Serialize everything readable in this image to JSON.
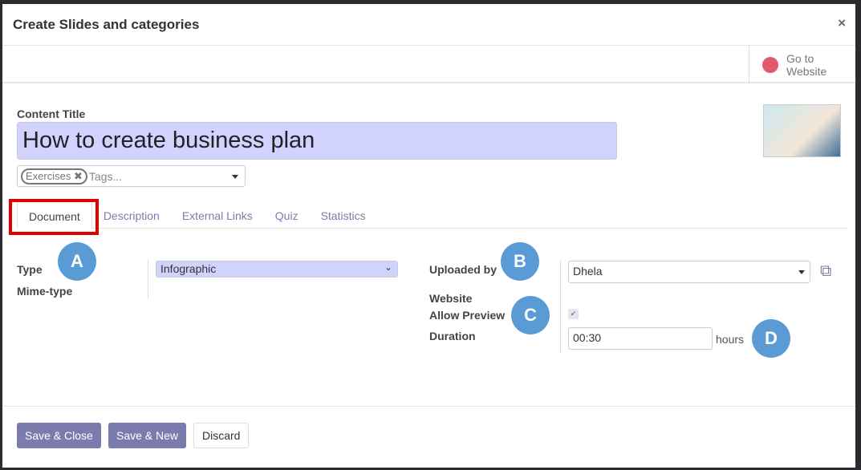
{
  "dialog": {
    "title": "Create Slides and categories",
    "close": "×"
  },
  "button_box": {
    "go_to_website": "Go to Website",
    "icon": "globe-icon"
  },
  "form": {
    "content_title_label": "Content Title",
    "content_title_value": "How to create business plan",
    "tags": {
      "chips": [
        "Exercises"
      ],
      "placeholder": "Tags..."
    },
    "tabs": [
      "Document",
      "Description",
      "External Links",
      "Quiz",
      "Statistics"
    ],
    "active_tab": "Document",
    "left": {
      "type_label": "Type",
      "type_value": "Infographic",
      "mime_label": "Mime-type"
    },
    "right": {
      "uploaded_by_label": "Uploaded by",
      "uploaded_by_value": "Dhela",
      "website_label": "Website",
      "allow_preview_label": "Allow Preview",
      "allow_preview_checked": true,
      "duration_label": "Duration",
      "duration_value": "00:30",
      "duration_unit": "hours"
    }
  },
  "annotations": [
    "A",
    "B",
    "C",
    "D"
  ],
  "footer": {
    "save_close": "Save & Close",
    "save_new": "Save & New",
    "discard": "Discard"
  },
  "colors": {
    "accent": "#7c7bad",
    "badge": "#5b9bd5",
    "highlight": "#e00000",
    "title_bg": "#d2d2ff"
  }
}
